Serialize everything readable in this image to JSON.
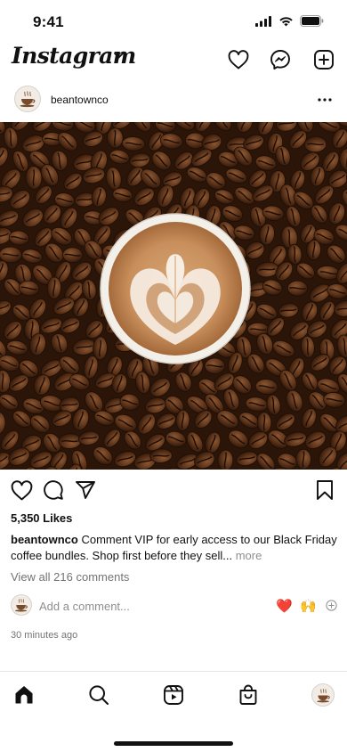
{
  "status_bar": {
    "time": "9:41",
    "icons": [
      "signal-icon",
      "wifi-icon",
      "battery-icon"
    ]
  },
  "header": {
    "logo_text": "Instagram",
    "icons": [
      "chevron-down-icon",
      "heart-icon",
      "messenger-icon",
      "new-post-icon"
    ]
  },
  "post": {
    "username": "beantownco",
    "image_description_icon": "latte-on-coffee-beans-photo",
    "likes": "5,350 Likes",
    "caption": {
      "user": "beantownco",
      "text": " Comment VIP for early access to our Black Friday coffee bundles. Shop first before they sell...",
      "more": " more"
    },
    "view_comments": "View all 216 comments",
    "add_comment_placeholder": "Add a comment...",
    "quick_emojis": [
      "❤️",
      "🙌"
    ],
    "timestamp": "30 minutes ago"
  },
  "colors": {
    "text": "#111111",
    "muted": "#737373",
    "heart_red": "#ff3040"
  },
  "nav": {
    "items": [
      "home-icon",
      "search-icon",
      "reels-icon",
      "shop-icon",
      "profile-avatar"
    ]
  }
}
